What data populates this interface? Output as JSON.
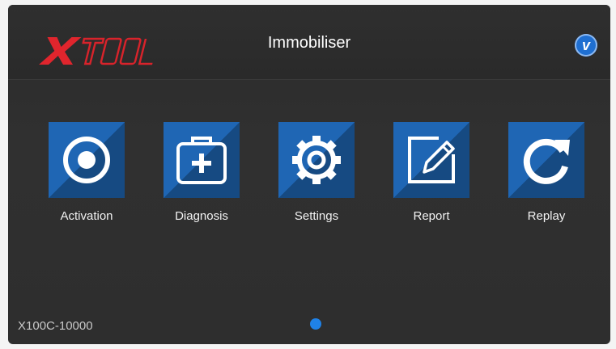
{
  "header": {
    "logo": "XTOOL",
    "title": "Immobiliser",
    "badge_icon": "v-badge-icon"
  },
  "apps": [
    {
      "label": "Activation",
      "icon": "activation-icon"
    },
    {
      "label": "Diagnosis",
      "icon": "diagnosis-icon"
    },
    {
      "label": "Settings",
      "icon": "settings-icon"
    },
    {
      "label": "Report",
      "icon": "report-icon"
    },
    {
      "label": "Replay",
      "icon": "replay-icon"
    }
  ],
  "footer": {
    "device_id": "X100C-10000",
    "page_indicator": "1"
  },
  "colors": {
    "tile": "#1f66b4",
    "accent": "#1f82e8",
    "logo": "#e0252d"
  }
}
